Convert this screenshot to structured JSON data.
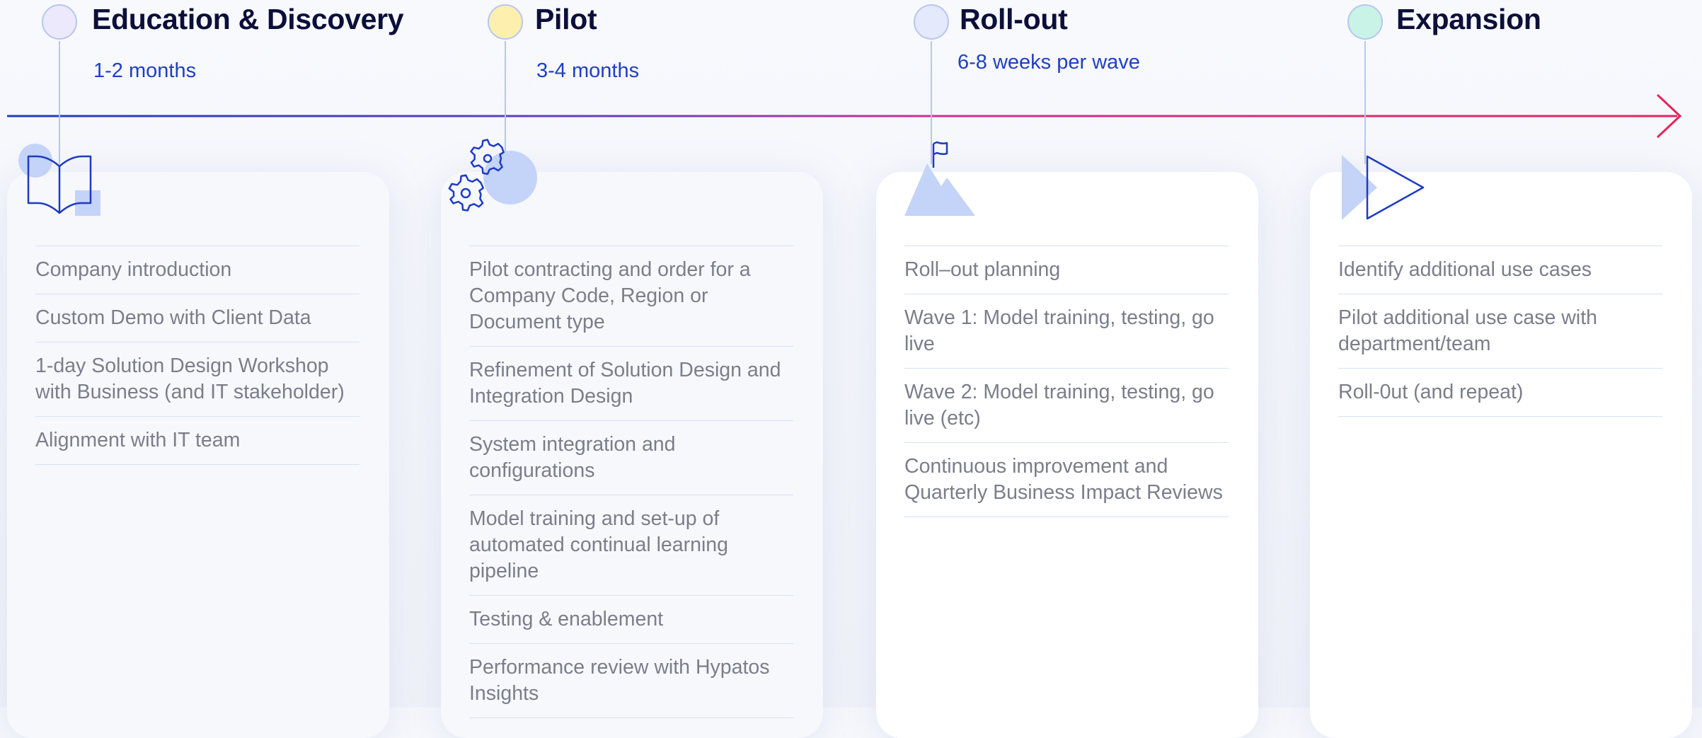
{
  "phases": [
    {
      "title": "Education & Discovery",
      "duration": "1-2 months",
      "dot_color": "#ece9fc",
      "card_style": "tint",
      "icon": "book-icon",
      "items": [
        "Company introduction",
        "Custom Demo with Client Data",
        "1-day Solution Design Workshop with Business (and IT stakeholder)",
        "Alignment with IT team"
      ]
    },
    {
      "title": "Pilot",
      "duration": "3-4 months",
      "dot_color": "#fdefae",
      "card_style": "tint",
      "icon": "gears-icon",
      "items": [
        "Pilot contracting and order for a Company Code, Region or Document type",
        "Refinement of Solution Design and Integration Design",
        "System integration and configurations",
        "Model training and set-up of automated continual learning pipeline",
        "Testing & enablement",
        "Performance review with Hypatos Insights"
      ]
    },
    {
      "title": "Roll-out",
      "duration": "6-8 weeks per wave",
      "dot_color": "#e4e9fb",
      "card_style": "white",
      "icon": "mountain-flag-icon",
      "items": [
        "Roll–out planning",
        "Wave 1: Model training, testing, go live",
        "Wave 2: Model training, testing, go live (etc)",
        "Continuous improvement and Quarterly Business Impact Reviews"
      ]
    },
    {
      "title": "Expansion",
      "duration": "",
      "dot_color": "#c9f3e6",
      "card_style": "white",
      "icon": "play-arrow-icon",
      "items": [
        "Identify additional use cases",
        "Pilot additional use case with department/team",
        "Roll-0ut (and repeat)"
      ]
    }
  ],
  "colors": {
    "title": "#0c0f3a",
    "duration": "#1f3fc4",
    "item_text": "#7b7e8a",
    "divider": "#d3e2f1",
    "timeline_start": "#1e3bc4",
    "timeline_end": "#e5245c",
    "icon_stroke": "#1e3bc4",
    "icon_fill": "#c4d3f8"
  }
}
